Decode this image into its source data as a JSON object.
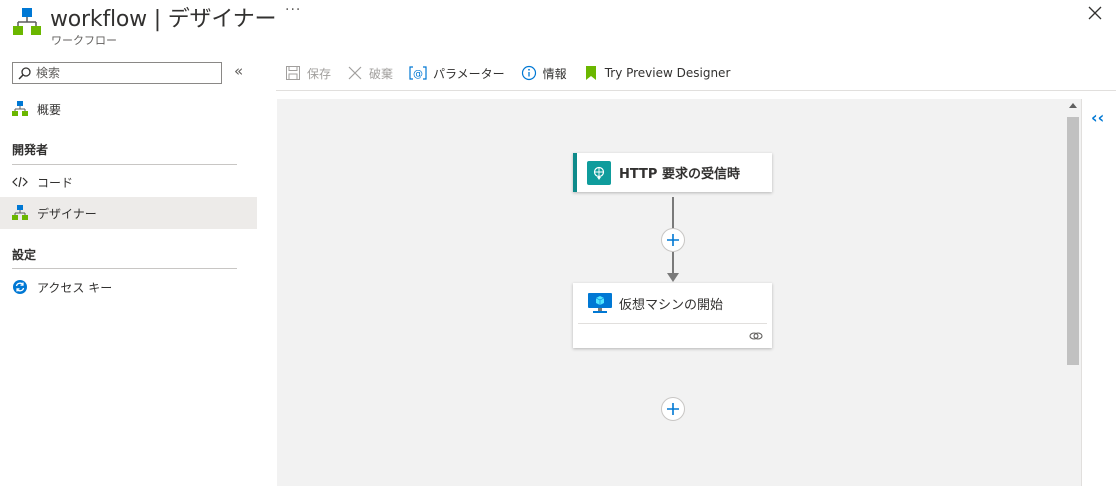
{
  "header": {
    "title": "workflow | デザイナー",
    "subtitle": "ワークフロー",
    "more_label": "···"
  },
  "sidebar": {
    "search_placeholder": "検索",
    "collapse_label": "«",
    "items": [
      {
        "label": "概要",
        "icon": "workflow-icon"
      },
      {
        "label": "コード",
        "icon": "code-icon"
      },
      {
        "label": "デザイナー",
        "icon": "designer-icon",
        "selected": true
      },
      {
        "label": "アクセス キー",
        "icon": "access-key-icon"
      }
    ],
    "sections": [
      "開発者",
      "設定"
    ]
  },
  "toolbar": {
    "save_label": "保存",
    "discard_label": "破棄",
    "parameters_label": "パラメーター",
    "info_label": "情報",
    "preview_label": "Try Preview Designer"
  },
  "canvas": {
    "trigger_title": "HTTP 要求の受信時",
    "action_title": "仮想マシンの開始",
    "expand_label": "‹‹"
  },
  "colors": {
    "accent": "#0078d4",
    "trigger_teal": "#0f9c9c",
    "preview_green": "#6bb700"
  }
}
